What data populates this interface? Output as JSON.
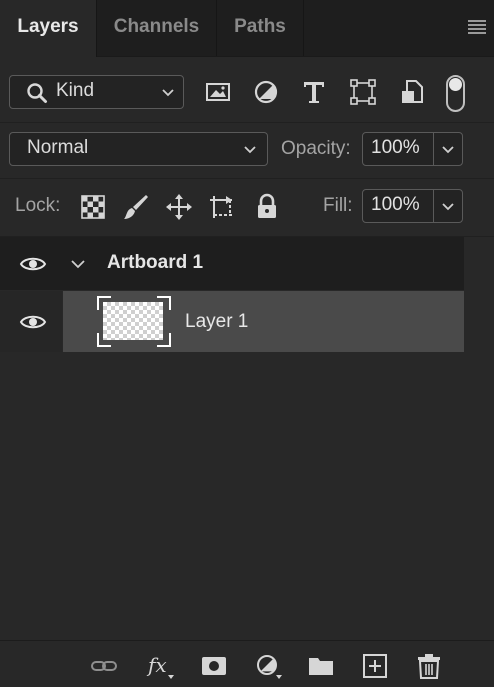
{
  "tabs": [
    {
      "label": "Layers",
      "active": true
    },
    {
      "label": "Channels",
      "active": false
    },
    {
      "label": "Paths",
      "active": false
    }
  ],
  "filter": {
    "kind_label": "Kind",
    "filter_icons": [
      "image-filter-icon",
      "adjustment-filter-icon",
      "type-filter-icon",
      "shape-filter-icon",
      "smart-object-filter-icon"
    ],
    "filter_toggle": "on"
  },
  "blend": {
    "mode": "Normal",
    "opacity_label": "Opacity:",
    "opacity_value": "100%"
  },
  "lock": {
    "label": "Lock:",
    "icons": [
      "lock-transparent-pixels-icon",
      "lock-image-pixels-icon",
      "lock-position-icon",
      "lock-artboard-icon",
      "lock-all-icon"
    ],
    "fill_label": "Fill:",
    "fill_value": "100%"
  },
  "layers": [
    {
      "name": "Artboard 1",
      "type": "artboard",
      "visible": true,
      "expanded": true
    },
    {
      "name": "Layer 1",
      "type": "pixel",
      "visible": true,
      "selected": true
    }
  ],
  "footer": {
    "icons": [
      "link-layers-icon",
      "fx-icon",
      "add-mask-icon",
      "adjustment-layer-icon",
      "new-group-icon",
      "new-layer-icon",
      "delete-layer-icon"
    ]
  },
  "colors": {
    "panel_bg": "#282828",
    "tabbar_bg": "#1e1e1e",
    "selected_row": "#4a4a4a",
    "text": "#d6d6d6"
  }
}
